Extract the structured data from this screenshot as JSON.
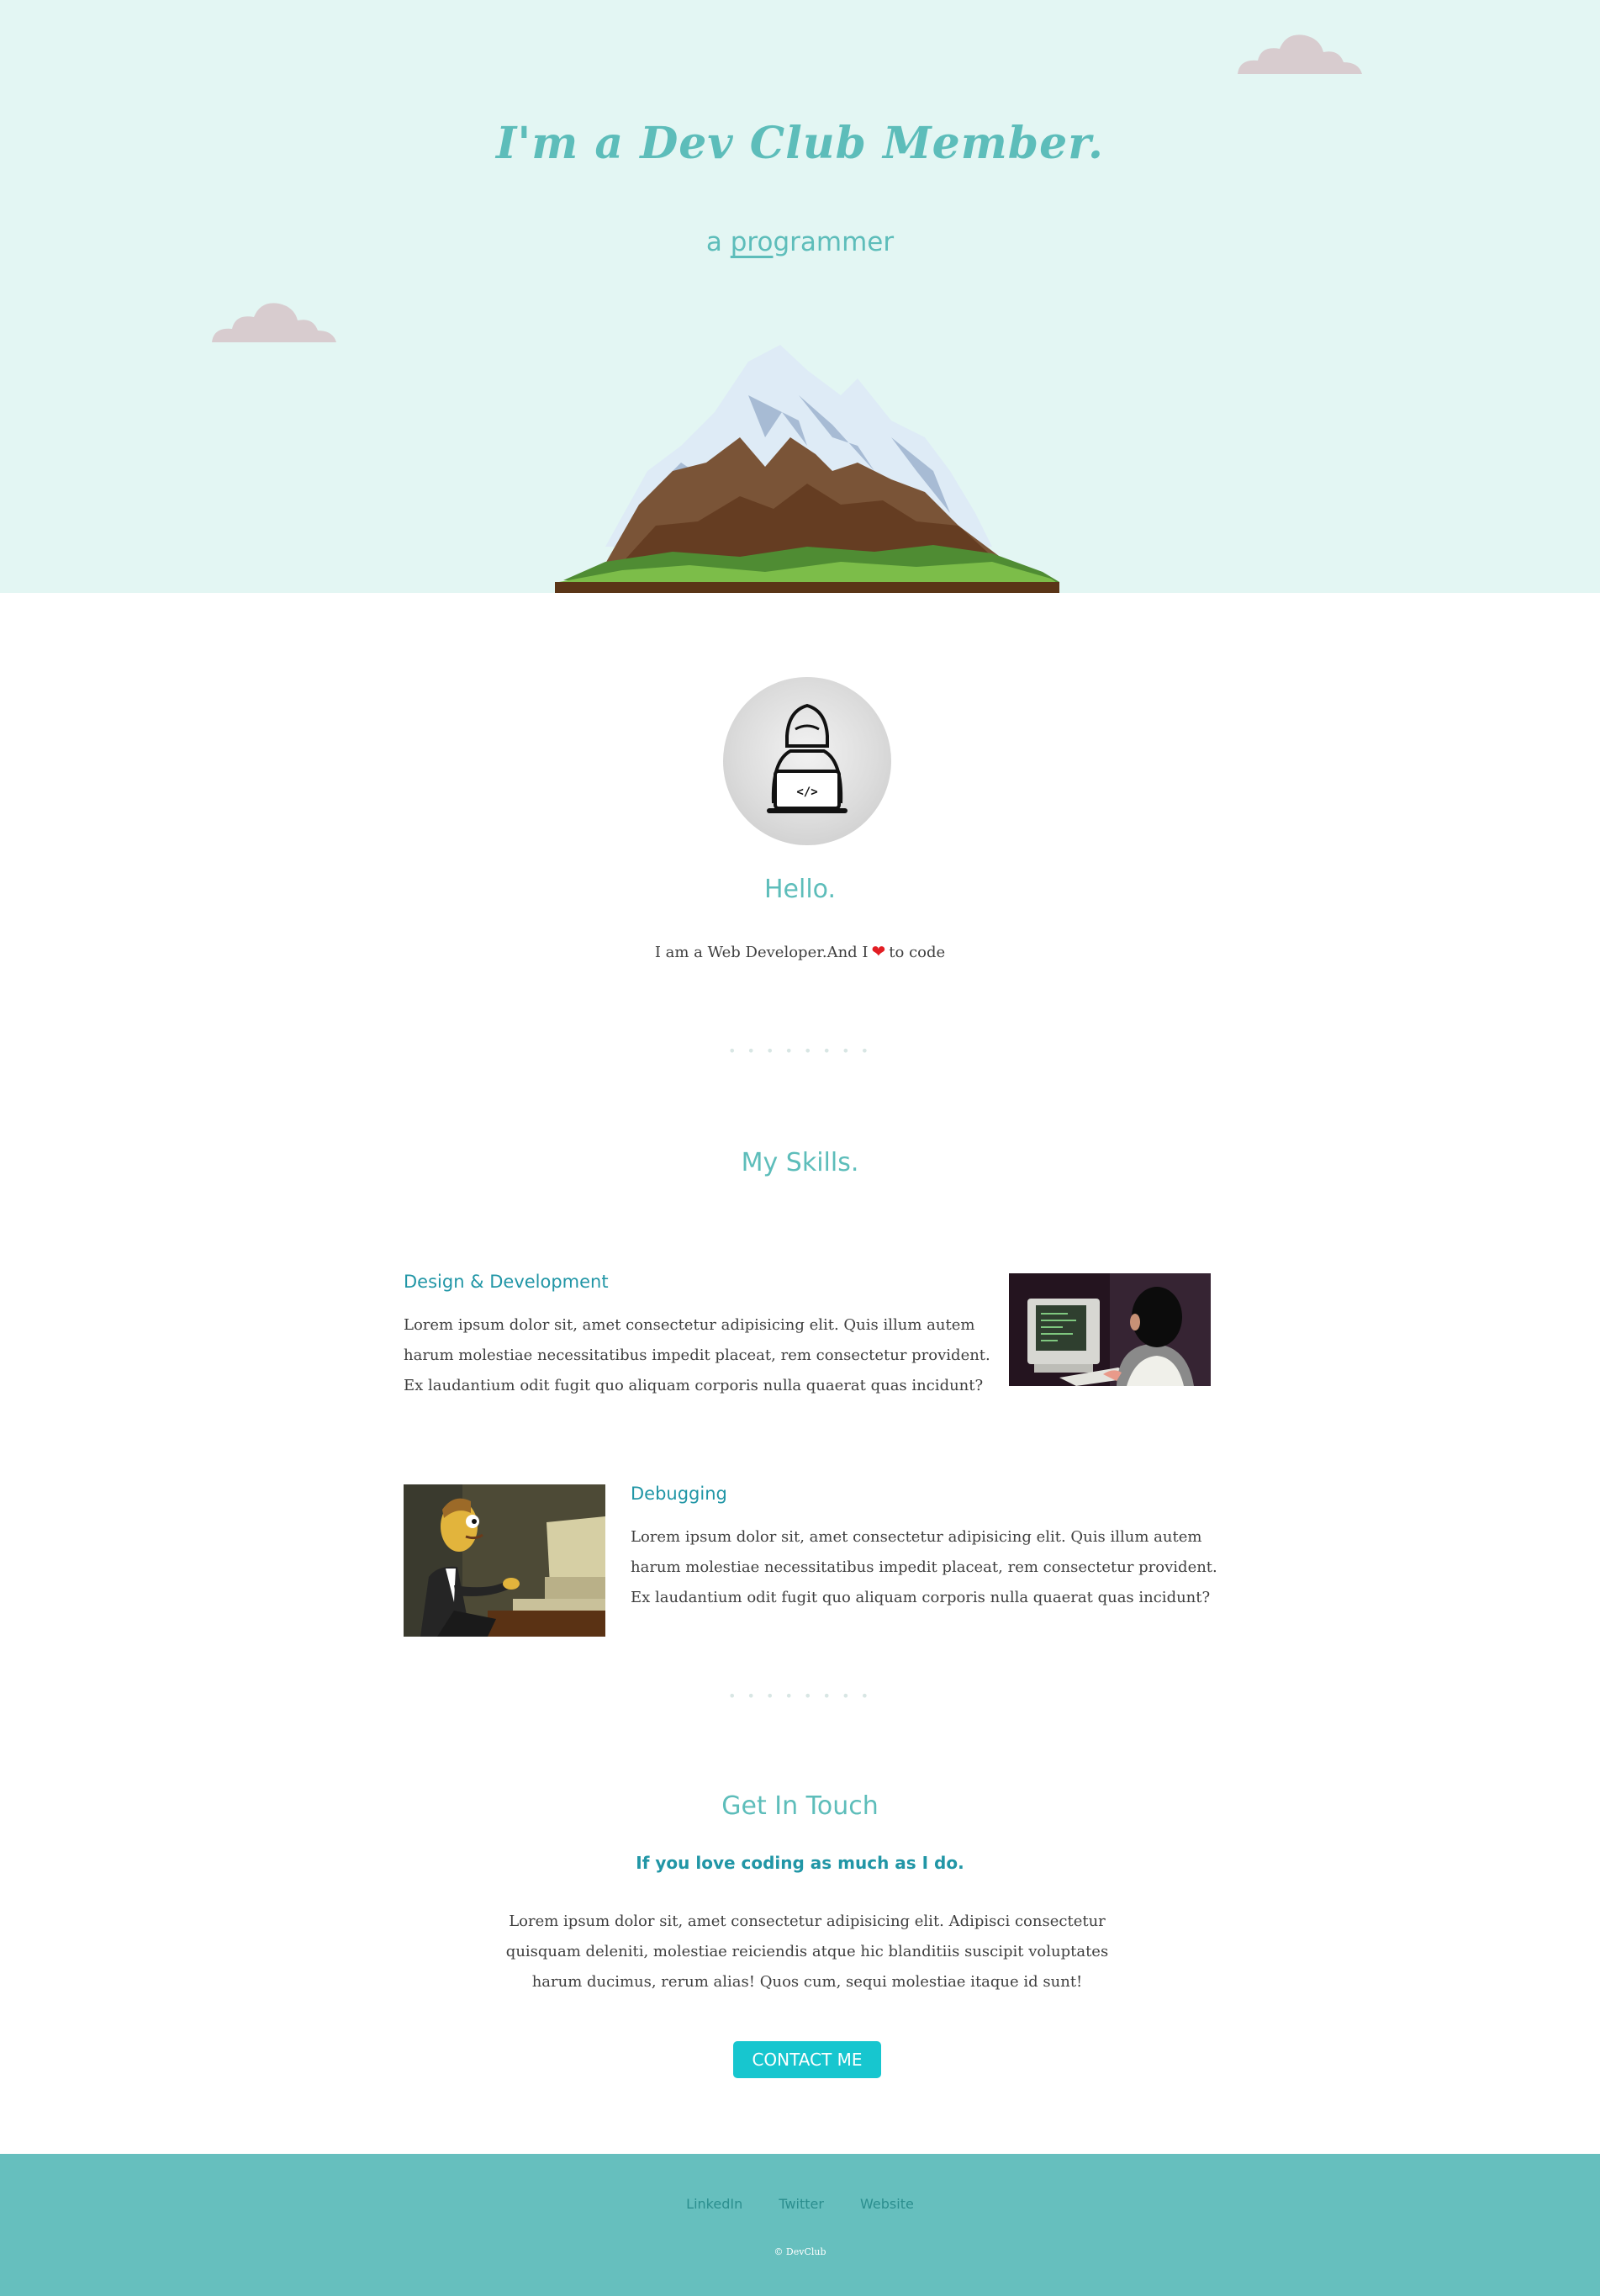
{
  "hero": {
    "title": "I'm a Dev Club Member.",
    "subtitle_prefix": "a ",
    "subtitle_typed": "pro",
    "subtitle_rest": "grammer"
  },
  "about": {
    "heading": "Hello.",
    "intro_before": "I am a Web Developer.And I",
    "intro_after": "to code",
    "heart": "❤"
  },
  "divider": "• • • • • • • •",
  "skills": {
    "title": "My Skills.",
    "items": [
      {
        "heading": "Design & Development",
        "text": "Lorem ipsum dolor sit, amet consectetur adipisicing elit. Quis illum autem harum molestiae necessitatibus impedit placeat, rem consectetur provident. Ex laudantium odit fugit quo aliquam corporis nulla quaerat quas incidunt?"
      },
      {
        "heading": "Debugging",
        "text": "Lorem ipsum dolor sit, amet consectetur adipisicing elit. Quis illum autem harum molestiae necessitatibus impedit placeat, rem consectetur provident. Ex laudantium odit fugit quo aliquam corporis nulla quaerat quas incidunt?"
      }
    ]
  },
  "contact": {
    "title": "Get In Touch",
    "subtitle": "If you love coding as much as I do.",
    "text": "Lorem ipsum dolor sit, amet consectetur adipisicing elit. Adipisci consectetur quisquam deleniti, molestiae reiciendis atque hic blanditiis suscipit voluptates harum ducimus, rerum alias! Quos cum, sequi molestiae itaque id sunt!",
    "button_label": "CONTACT ME"
  },
  "footer": {
    "links": [
      "LinkedIn",
      "Twitter",
      "Website"
    ],
    "copyright": "© DevClub"
  },
  "colors": {
    "hero_bg": "#e3f6f3",
    "accent": "#5dbdba",
    "heading_teal": "#2196a6",
    "button": "#17c6cf",
    "footer_bg": "#66bfbe"
  }
}
